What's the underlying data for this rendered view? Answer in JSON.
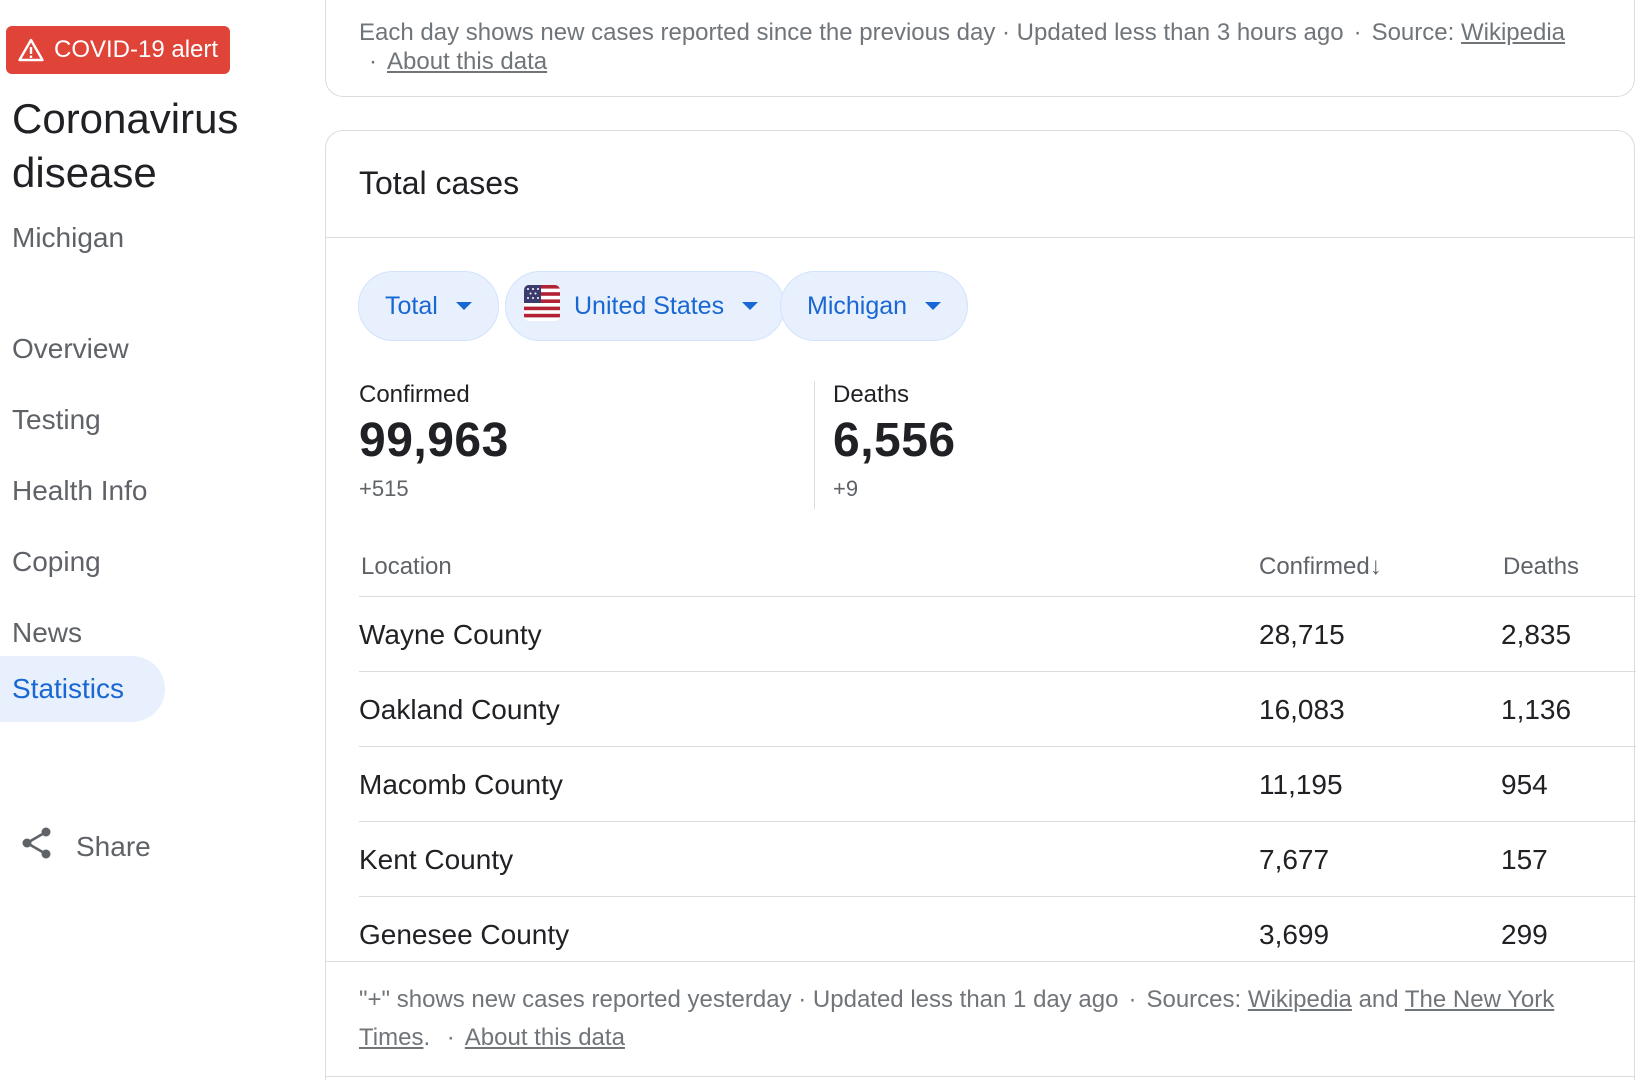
{
  "alert": {
    "label": "COVID-19 alert",
    "color": "#e04338"
  },
  "sidebar": {
    "title": "Coronavirus disease",
    "subtitle": "Michigan",
    "nav": [
      {
        "label": "Overview"
      },
      {
        "label": "Testing"
      },
      {
        "label": "Health Info"
      },
      {
        "label": "Coping"
      },
      {
        "label": "News"
      },
      {
        "label": "Statistics",
        "active": true
      }
    ],
    "share_label": "Share"
  },
  "top_card": {
    "footer_text": "Each day shows new cases reported since the previous day · Updated less than 3 hours ago",
    "source_label": "Source:",
    "source_link": "Wikipedia",
    "about_link": "About this data"
  },
  "main_card": {
    "title": "Total cases",
    "chips": [
      {
        "label": "Total",
        "icon": "caret-down-icon"
      },
      {
        "label": "United States",
        "icon": "us-flag-icon"
      },
      {
        "label": "Michigan",
        "icon": "caret-down-icon"
      }
    ],
    "stats": {
      "confirmed": {
        "label": "Confirmed",
        "value": "99,963",
        "delta": "+515"
      },
      "deaths": {
        "label": "Deaths",
        "value": "6,556",
        "delta": "+9"
      }
    },
    "table": {
      "headers": {
        "location": "Location",
        "confirmed": "Confirmed",
        "deaths": "Deaths",
        "sort_icon": "↓"
      },
      "rows": [
        {
          "location": "Wayne County",
          "confirmed": "28,715",
          "deaths": "2,835"
        },
        {
          "location": "Oakland County",
          "confirmed": "16,083",
          "deaths": "1,136"
        },
        {
          "location": "Macomb County",
          "confirmed": "11,195",
          "deaths": "954"
        },
        {
          "location": "Kent County",
          "confirmed": "7,677",
          "deaths": "157"
        },
        {
          "location": "Genesee County",
          "confirmed": "3,699",
          "deaths": "299"
        }
      ]
    },
    "footer": {
      "text": "\"+\" shows new cases reported yesterday · Updated less than 1 day ago",
      "sources_label": "Sources:",
      "source1": "Wikipedia",
      "and": "and",
      "source2": "The New York Times",
      "period": ".",
      "about_link": "About this data"
    }
  },
  "colors": {
    "accent": "#1967d2",
    "chip_bg": "#e8f0fe",
    "alert": "#e04338"
  }
}
